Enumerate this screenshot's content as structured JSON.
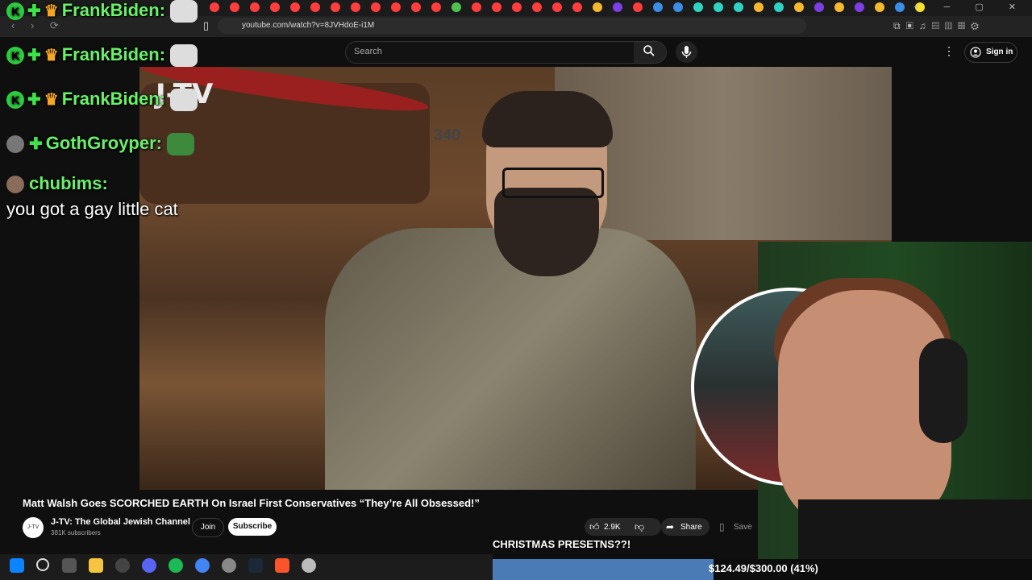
{
  "browser": {
    "url": "youtube.com/watch?v=8JVHdoE-i1M"
  },
  "youtube": {
    "search_placeholder": "Search",
    "sign_in_label": "Sign in"
  },
  "video": {
    "title": "Matt Walsh Goes SCORCHED EARTH On Israel First Conservatives “They’re All Obsessed!”",
    "channel_logo_text": "J-TV",
    "channel_name": "J-TV: The Global Jewish Channel",
    "subscribers": "381K subscribers",
    "join_label": "Join",
    "subscribe_label": "Subscribe",
    "like_count": "2.9K",
    "share_label": "Share",
    "save_label": "Save",
    "watermark": "J-TV",
    "background_number": "340"
  },
  "chat": [
    {
      "username": "FrankBiden:",
      "badges": [
        "k-badge",
        "plus-badge",
        "crown-badge"
      ],
      "emote": "cat-emote"
    },
    {
      "username": "FrankBiden:",
      "badges": [
        "k-badge",
        "plus-badge",
        "crown-badge"
      ],
      "emote": "cat-emote"
    },
    {
      "username": "FrankBiden:",
      "badges": [
        "k-badge",
        "plus-badge",
        "crown-badge"
      ],
      "emote": "cat-emote"
    },
    {
      "username": "GothGroyper:",
      "badges": [
        "avatar",
        "plus-badge"
      ],
      "emote": "frog-emote"
    },
    {
      "username": "chubims:",
      "badges": [
        "avatar"
      ],
      "message": "you got a gay little cat"
    }
  ],
  "stream_overlay": {
    "donation_message": "CHRISTMAS PRESETNS??!",
    "goal_text": "$124.49/$300.00 (41%)",
    "goal_fraction": 0.41
  },
  "colors": {
    "chat_name": "#69f269",
    "goal_fill": "#4a7bb5",
    "youtube_bg": "#0f0f0f"
  }
}
